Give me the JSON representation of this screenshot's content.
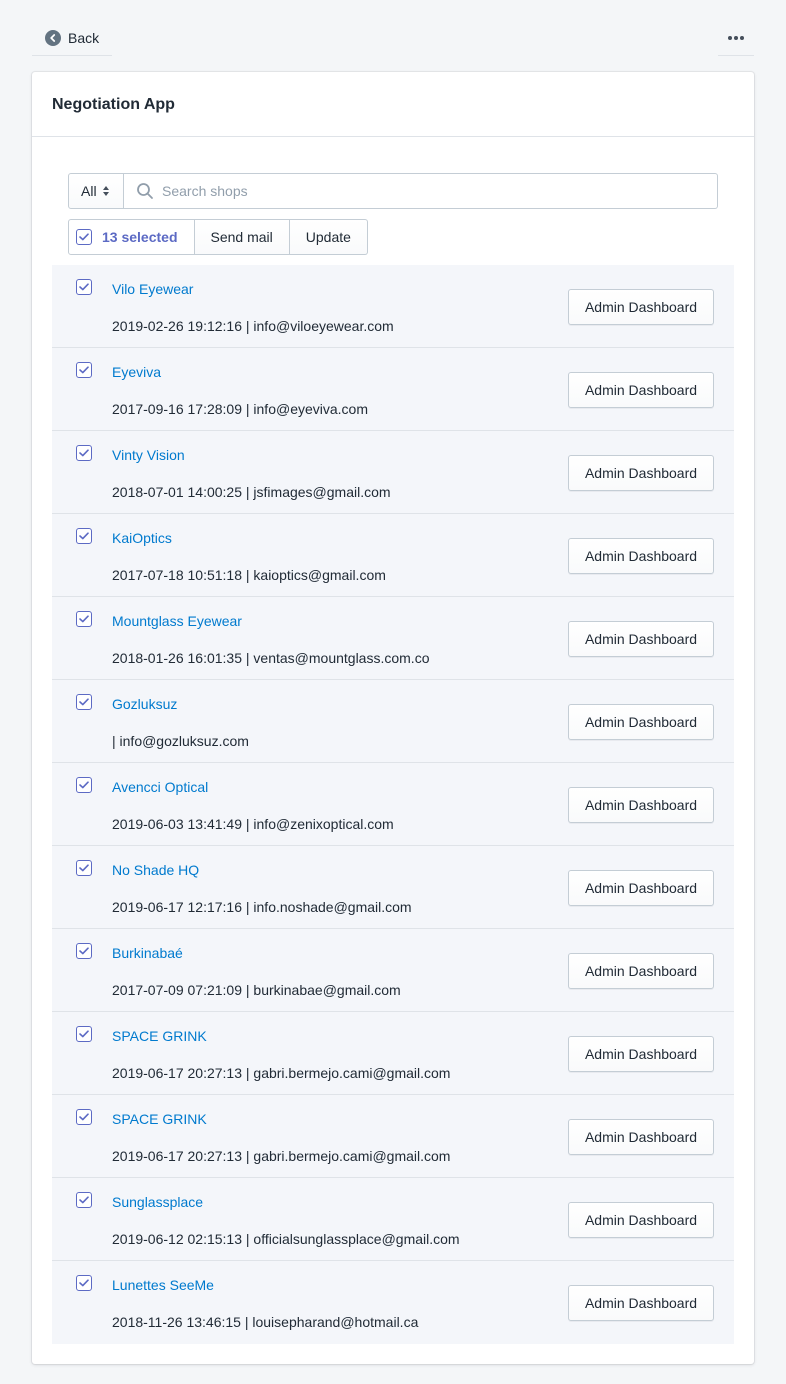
{
  "topbar": {
    "back_label": "Back"
  },
  "card": {
    "title": "Negotiation App"
  },
  "filter": {
    "selected": "All",
    "search_placeholder": "Search shops",
    "search_value": ""
  },
  "bulk": {
    "selected_label": "13 selected",
    "send_mail_label": "Send mail",
    "update_label": "Update"
  },
  "colors": {
    "accent": "#5c6ac4",
    "link": "#007ace",
    "row_bg": "#f4f6fa"
  },
  "shops": [
    {
      "name": "Vilo Eyewear",
      "meta": "2019-02-26 19:12:16 | info@viloeyewear.com",
      "checked": true,
      "action": "Admin Dashboard"
    },
    {
      "name": "Eyeviva",
      "meta": "2017-09-16 17:28:09 | info@eyeviva.com",
      "checked": true,
      "action": "Admin Dashboard"
    },
    {
      "name": "Vinty Vision",
      "meta": "2018-07-01 14:00:25 | jsfimages@gmail.com",
      "checked": true,
      "action": "Admin Dashboard"
    },
    {
      "name": "KaiOptics",
      "meta": "2017-07-18 10:51:18 | kaioptics@gmail.com",
      "checked": true,
      "action": "Admin Dashboard"
    },
    {
      "name": "Mountglass Eyewear",
      "meta": "2018-01-26 16:01:35 | ventas@mountglass.com.co",
      "checked": true,
      "action": "Admin Dashboard"
    },
    {
      "name": "Gozluksuz",
      "meta": "| info@gozluksuz.com",
      "checked": true,
      "action": "Admin Dashboard"
    },
    {
      "name": "Avencci Optical",
      "meta": "2019-06-03 13:41:49 | info@zenixoptical.com",
      "checked": true,
      "action": "Admin Dashboard"
    },
    {
      "name": "No Shade HQ",
      "meta": "2019-06-17 12:17:16 | info.noshade@gmail.com",
      "checked": true,
      "action": "Admin Dashboard"
    },
    {
      "name": "Burkinabaé",
      "meta": "2017-07-09 07:21:09 | burkinabae@gmail.com",
      "checked": true,
      "action": "Admin Dashboard"
    },
    {
      "name": "SPACE GRINK",
      "meta": "2019-06-17 20:27:13 | gabri.bermejo.cami@gmail.com",
      "checked": true,
      "action": "Admin Dashboard"
    },
    {
      "name": "SPACE GRINK",
      "meta": "2019-06-17 20:27:13 | gabri.bermejo.cami@gmail.com",
      "checked": true,
      "action": "Admin Dashboard"
    },
    {
      "name": "Sunglassplace",
      "meta": "2019-06-12 02:15:13 | officialsunglassplace@gmail.com",
      "checked": true,
      "action": "Admin Dashboard"
    },
    {
      "name": "Lunettes SeeMe",
      "meta": "2018-11-26 13:46:15 | louisepharand@hotmail.ca",
      "checked": true,
      "action": "Admin Dashboard"
    }
  ]
}
